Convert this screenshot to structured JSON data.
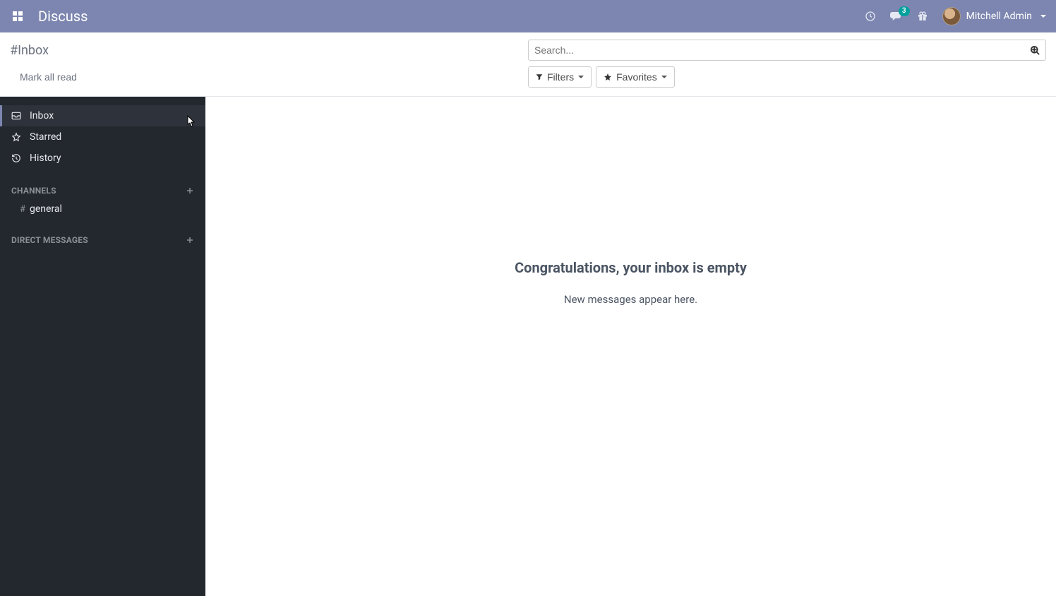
{
  "header": {
    "app_title": "Discuss",
    "user_name": "Mitchell Admin",
    "msg_badge": "3"
  },
  "control": {
    "breadcrumb": "#Inbox",
    "mark_all_read": "Mark all read",
    "search_placeholder": "Search...",
    "filters_label": "Filters",
    "favorites_label": "Favorites"
  },
  "sidebar": {
    "items": [
      {
        "label": "Inbox"
      },
      {
        "label": "Starred"
      },
      {
        "label": "History"
      }
    ],
    "channels_header": "CHANNELS",
    "channels": [
      {
        "label": "general"
      }
    ],
    "dm_header": "DIRECT MESSAGES"
  },
  "empty": {
    "title": "Congratulations, your inbox is empty",
    "subtitle": "New messages appear here."
  }
}
